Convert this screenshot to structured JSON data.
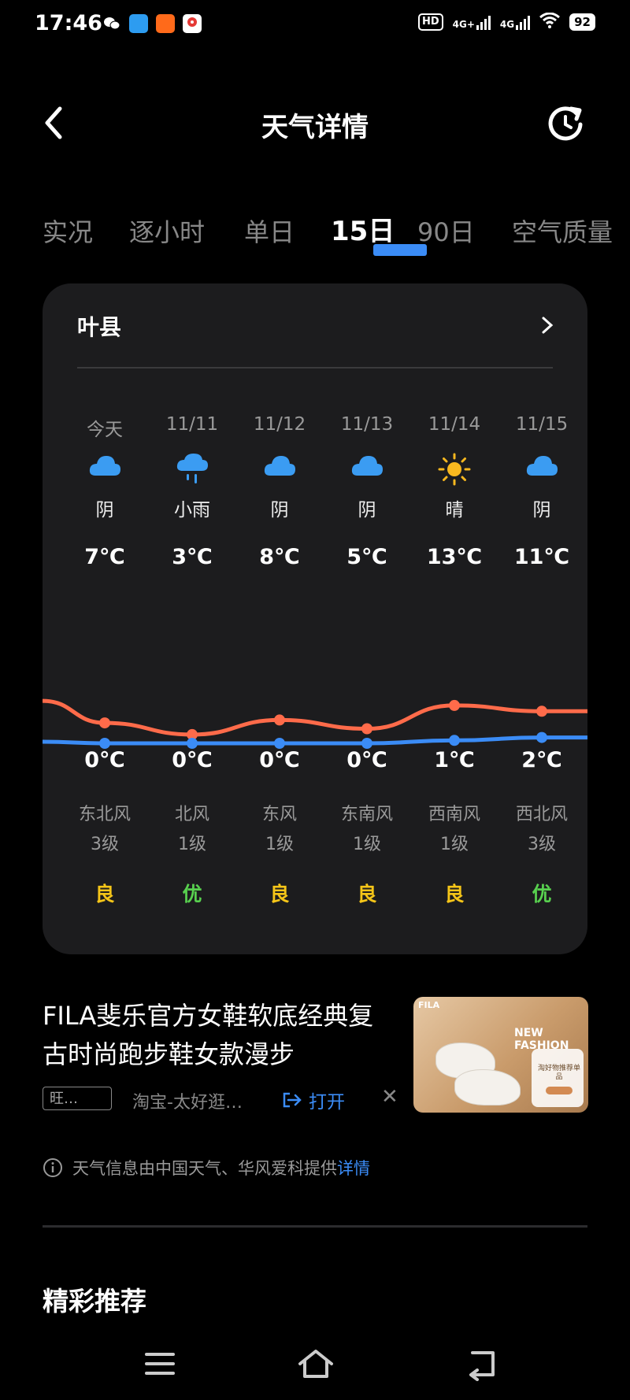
{
  "status": {
    "time": "17:46",
    "hd": "HD",
    "net1": "4G+",
    "net2": "4G",
    "battery": "92"
  },
  "header": {
    "title": "天气详情"
  },
  "tabs": [
    {
      "label": "实况"
    },
    {
      "label": "逐小时"
    },
    {
      "label": "单日"
    },
    {
      "label": "15日"
    },
    {
      "label": "90日"
    },
    {
      "label": "空气质量"
    }
  ],
  "active_tab": "15日",
  "card": {
    "city": "叶县",
    "days": [
      {
        "date": "今天",
        "icon": "cloud-icon",
        "desc": "阴",
        "high": "7℃",
        "low": "0℃",
        "wind_dir": "东北风",
        "wind_lvl": "3级",
        "aqi": "良"
      },
      {
        "date": "11/11",
        "icon": "rain-icon",
        "desc": "小雨",
        "high": "3℃",
        "low": "0℃",
        "wind_dir": "北风",
        "wind_lvl": "1级",
        "aqi": "优"
      },
      {
        "date": "11/12",
        "icon": "cloud-icon",
        "desc": "阴",
        "high": "8℃",
        "low": "0℃",
        "wind_dir": "东风",
        "wind_lvl": "1级",
        "aqi": "良"
      },
      {
        "date": "11/13",
        "icon": "cloud-icon",
        "desc": "阴",
        "high": "5℃",
        "low": "0℃",
        "wind_dir": "东南风",
        "wind_lvl": "1级",
        "aqi": "良"
      },
      {
        "date": "11/14",
        "icon": "sun-icon",
        "desc": "晴",
        "high": "13℃",
        "low": "1℃",
        "wind_dir": "西南风",
        "wind_lvl": "1级",
        "aqi": "良"
      },
      {
        "date": "11/15",
        "icon": "cloud-icon",
        "desc": "阴",
        "high": "11℃",
        "low": "2℃",
        "wind_dir": "西北风",
        "wind_lvl": "3级",
        "aqi": "优"
      }
    ]
  },
  "chart_data": {
    "type": "line",
    "categories": [
      "今天",
      "11/11",
      "11/12",
      "11/13",
      "11/14",
      "11/15"
    ],
    "series": [
      {
        "values": [
          7,
          3,
          8,
          5,
          13,
          11
        ],
        "color": "#ff6b4a"
      },
      {
        "values": [
          0,
          0,
          0,
          0,
          1,
          2
        ],
        "color": "#3b8cf6"
      }
    ]
  },
  "colors": {
    "aqi_good": "#f5c518",
    "aqi_excellent": "#58d14f",
    "accent": "#3b8cf6"
  },
  "ad": {
    "title": "FILA斐乐官方女鞋软底经典复古时尚跑步鞋女款漫步",
    "tag": "旺…",
    "source": "淘宝-太好逛…",
    "open_label": "打开",
    "close_label": "✕",
    "img_logo": "FILA",
    "img_big": "NEW FASHION",
    "img_panel": "淘好物推荐单品"
  },
  "info": {
    "text": "天气信息由中国天气、华风爱科提供",
    "link": "详情"
  },
  "recommend": {
    "title": "精彩推荐"
  }
}
